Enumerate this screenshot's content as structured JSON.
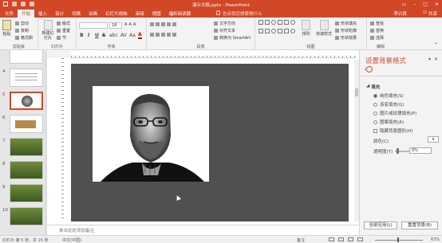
{
  "window": {
    "title": "演示文稿.pptx - PowerPoint",
    "user": "李兴良",
    "share_label": "共享"
  },
  "tabs": [
    "文件",
    "开始",
    "插入",
    "设计",
    "切换",
    "动画",
    "幻灯片放映",
    "审阅",
    "视图",
    "福昕阅读器"
  ],
  "active_tab": "开始",
  "tell_me": "告诉我您想要做什么",
  "ribbon": {
    "clipboard": {
      "paste": "粘贴",
      "cut": "剪切",
      "copy": "复制",
      "format_painter": "格式刷",
      "label": "剪贴板"
    },
    "slides": {
      "new_slide": "新建幻灯片",
      "layout": "版式",
      "reset": "重置",
      "section": "节",
      "label": "幻灯片"
    },
    "font": {
      "size": "18",
      "bold": "B",
      "italic": "I",
      "underline": "U",
      "strike": "S",
      "shadow": "abc",
      "spacing": "AV",
      "case": "Aa",
      "color": "A",
      "label": "字体"
    },
    "paragraph": {
      "text_direction": "文字方向",
      "align_text": "对齐文本",
      "smartart": "转换为 SmartArt",
      "label": "段落"
    },
    "drawing": {
      "arrange": "排列",
      "quick_styles": "快速样式",
      "shape_fill": "形状填充",
      "shape_outline": "形状轮廓",
      "shape_effects": "形状效果",
      "label": "绘图"
    },
    "editing": {
      "find": "查找",
      "replace": "替换",
      "select": "选择",
      "label": "编辑"
    }
  },
  "slides": [
    {
      "num": "3"
    },
    {
      "num": "4"
    },
    {
      "num": "5",
      "selected": true
    },
    {
      "num": "6"
    },
    {
      "num": "7"
    },
    {
      "num": "8"
    },
    {
      "num": "9"
    },
    {
      "num": "10"
    }
  ],
  "notes_placeholder": "单击此处添加备注",
  "format_pane": {
    "title": "设置背景格式",
    "section": "填充",
    "options": [
      "纯色填充(S)",
      "渐变填充(G)",
      "图片或纹理填充(P)",
      "图案填充(A)"
    ],
    "selected_option": 0,
    "hide_background": "隐藏背景图形(H)",
    "color_label": "颜色(C)",
    "transparency_label": "透明度(T)",
    "transparency_value": "0%",
    "transparency": 0,
    "apply_all": "全部应用(L)",
    "reset_background": "重置背景(B)"
  },
  "status": {
    "slide_info": "幻灯片 第 5 张，共 15 张",
    "language": "中文(中国)",
    "notes": "备注",
    "zoom": "63%"
  }
}
